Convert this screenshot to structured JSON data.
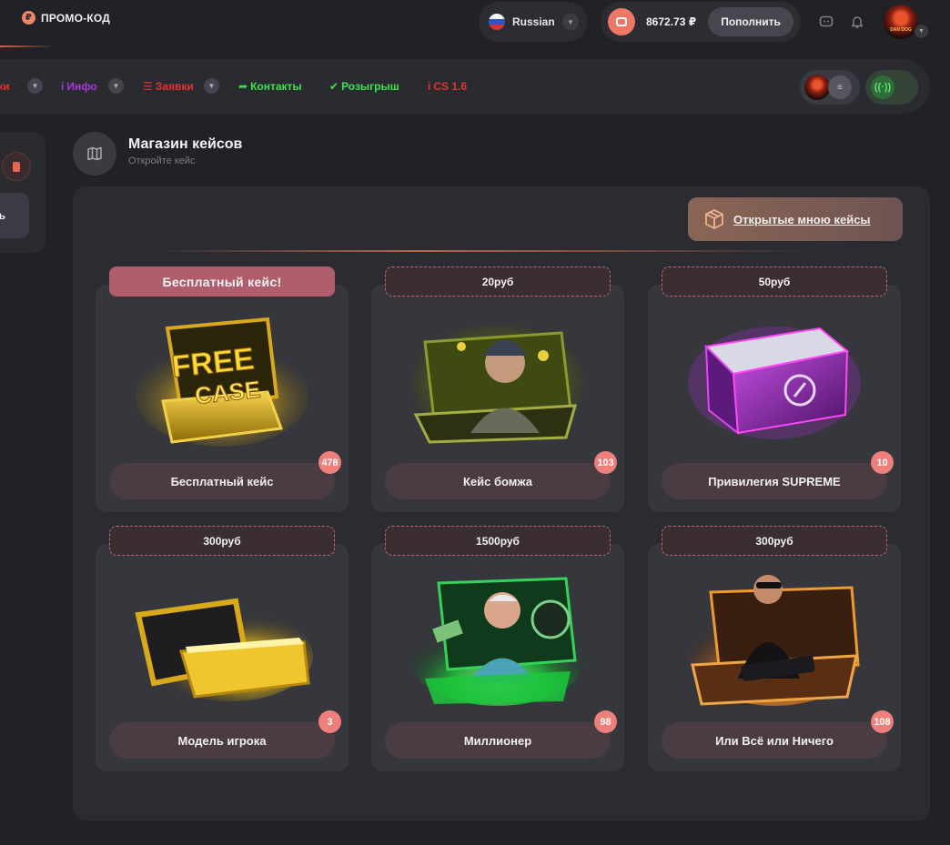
{
  "topbar": {
    "promo_label": "ПРОМО-КОД",
    "promo_icon": "ruble-coin-icon",
    "language": "Russian",
    "balance": "8672.73 ₽",
    "topup_label": "Пополнить",
    "avatar_text": "DAN DOG"
  },
  "nav": {
    "items": [
      {
        "label": "вки",
        "color": "#e5322f"
      },
      {
        "label": "Инфо",
        "color": "#a43ad8"
      },
      {
        "label": "Заявки",
        "color": "#e5322f"
      },
      {
        "label": "Контакты",
        "color": "#3fe24c"
      },
      {
        "label": "Розыгрыш",
        "color": "#3fe24c"
      },
      {
        "label": "CS 1.6",
        "color": "#e5322f"
      }
    ]
  },
  "sidebar": {
    "button_label": "ь"
  },
  "page": {
    "title": "Магазин кейсов",
    "subtitle": "Откройте кейс",
    "opened_cases_label": "Открытые мною кейсы"
  },
  "cases": [
    {
      "price": "Бесплатный кейс!",
      "name": "Бесплатный кейс",
      "count": "478",
      "theme": "gold",
      "art_text": "FREE CASE"
    },
    {
      "price": "20руб",
      "name": "Кейс бомжа",
      "count": "103",
      "theme": "olive",
      "art_text": ""
    },
    {
      "price": "50руб",
      "name": "Привилегия SUPREME",
      "count": "10",
      "theme": "purple",
      "art_text": ""
    },
    {
      "price": "300руб",
      "name": "Модель игрока",
      "count": "3",
      "theme": "yellow",
      "art_text": ""
    },
    {
      "price": "1500руб",
      "name": "Миллионер",
      "count": "98",
      "theme": "green",
      "art_text": ""
    },
    {
      "price": "300руб",
      "name": "Или Всё или Ничего",
      "count": "108",
      "theme": "orange",
      "art_text": ""
    }
  ],
  "colors": {
    "accent": "#ef7766",
    "free_tag": "#b05e6c",
    "nav_red": "#e5322f",
    "nav_green": "#3fe24c",
    "nav_purple": "#a43ad8"
  }
}
